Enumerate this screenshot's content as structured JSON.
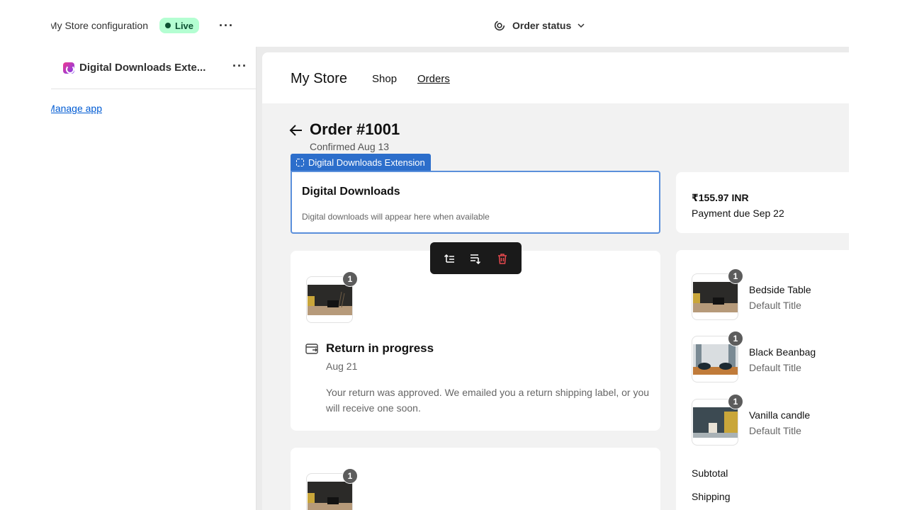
{
  "topbar": {
    "store_config": "My Store configuration",
    "live_label": "Live",
    "more_label": "···",
    "order_status_label": "Order status"
  },
  "left_panel": {
    "extension_name": "Digital Downloads Exte...",
    "more_label": "···",
    "manage_app_label": "Manage app"
  },
  "store": {
    "name": "My Store",
    "nav": {
      "shop": "Shop",
      "orders": "Orders"
    }
  },
  "order": {
    "title": "Order #1001",
    "confirmed": "Confirmed Aug 13"
  },
  "extension_block": {
    "label": "Digital Downloads Extension",
    "title": "Digital Downloads",
    "subtitle": "Digital downloads will appear here when available"
  },
  "payment": {
    "amount": "₹155.97 INR",
    "due": "Payment due Sep 22"
  },
  "return": {
    "quantity": "1",
    "title": "Return in progress",
    "date": "Aug 21",
    "text": "Your return was approved. We emailed you a return shipping label, or you will receive one soon."
  },
  "return2": {
    "quantity": "1"
  },
  "items": [
    {
      "name": "Bedside Table",
      "variant": "Default Title",
      "quantity": "1"
    },
    {
      "name": "Black Beanbag",
      "variant": "Default Title",
      "quantity": "1"
    },
    {
      "name": "Vanilla candle",
      "variant": "Default Title",
      "quantity": "1"
    }
  ],
  "summary": {
    "subtotal_label": "Subtotal",
    "shipping_label": "Shipping"
  },
  "colors": {
    "accent": "#2c6ecb",
    "live_bg": "#b4fed2",
    "delete": "#e5484d"
  }
}
